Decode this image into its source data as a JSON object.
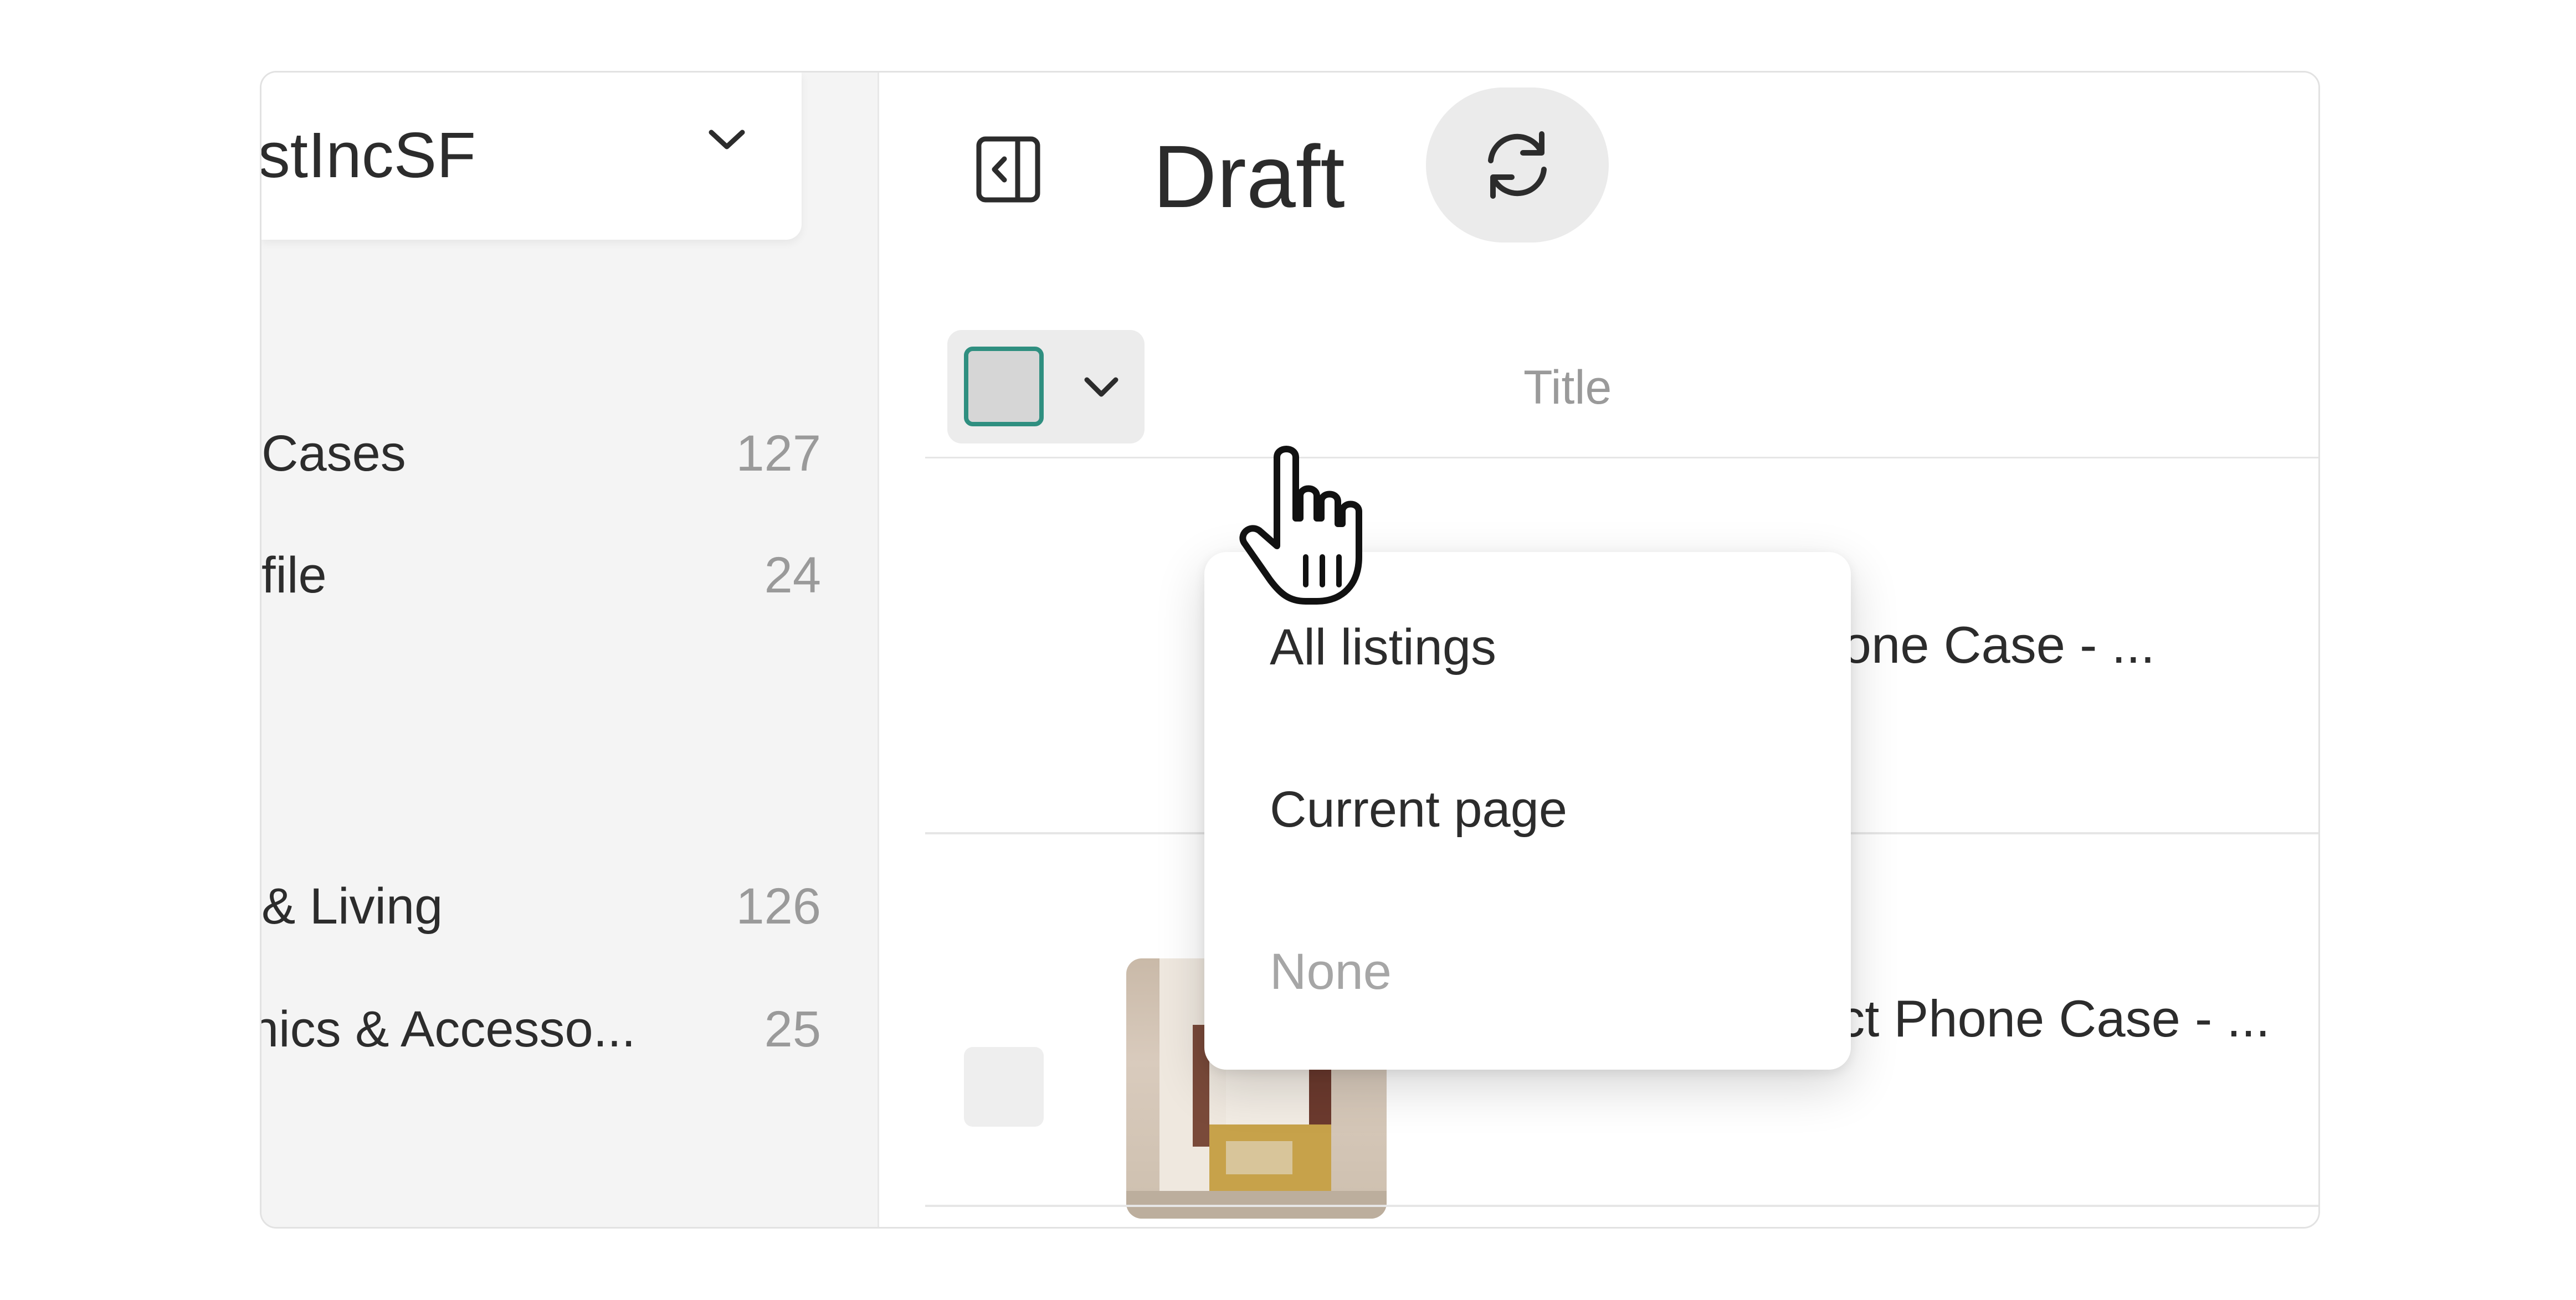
{
  "sidebar": {
    "shop_name": "istIncSF",
    "items": [
      {
        "label": "Cases",
        "count": "127"
      },
      {
        "label": "file",
        "count": "24"
      },
      {
        "label": "& Living",
        "count": "126"
      },
      {
        "label": "nics & Accesso...",
        "count": "25"
      }
    ]
  },
  "header": {
    "title": "Draft"
  },
  "table": {
    "column_title": "Title",
    "rows": [
      {
        "title": "Checkered Phone Case - ..."
      },
      {
        "title": "Earthy Abstract Phone Case - ..."
      }
    ]
  },
  "select_menu": {
    "items": [
      {
        "label": "All listings"
      },
      {
        "label": "Current page"
      },
      {
        "label": "None"
      }
    ]
  },
  "colors": {
    "accent": "#2f8f80",
    "sidebar_bg": "#f4f4f4",
    "muted_text": "#9a9a9a"
  },
  "icons": [
    "chevron-down-icon",
    "sidebar-collapse-icon",
    "refresh-icon",
    "hand-pointer-icon"
  ]
}
